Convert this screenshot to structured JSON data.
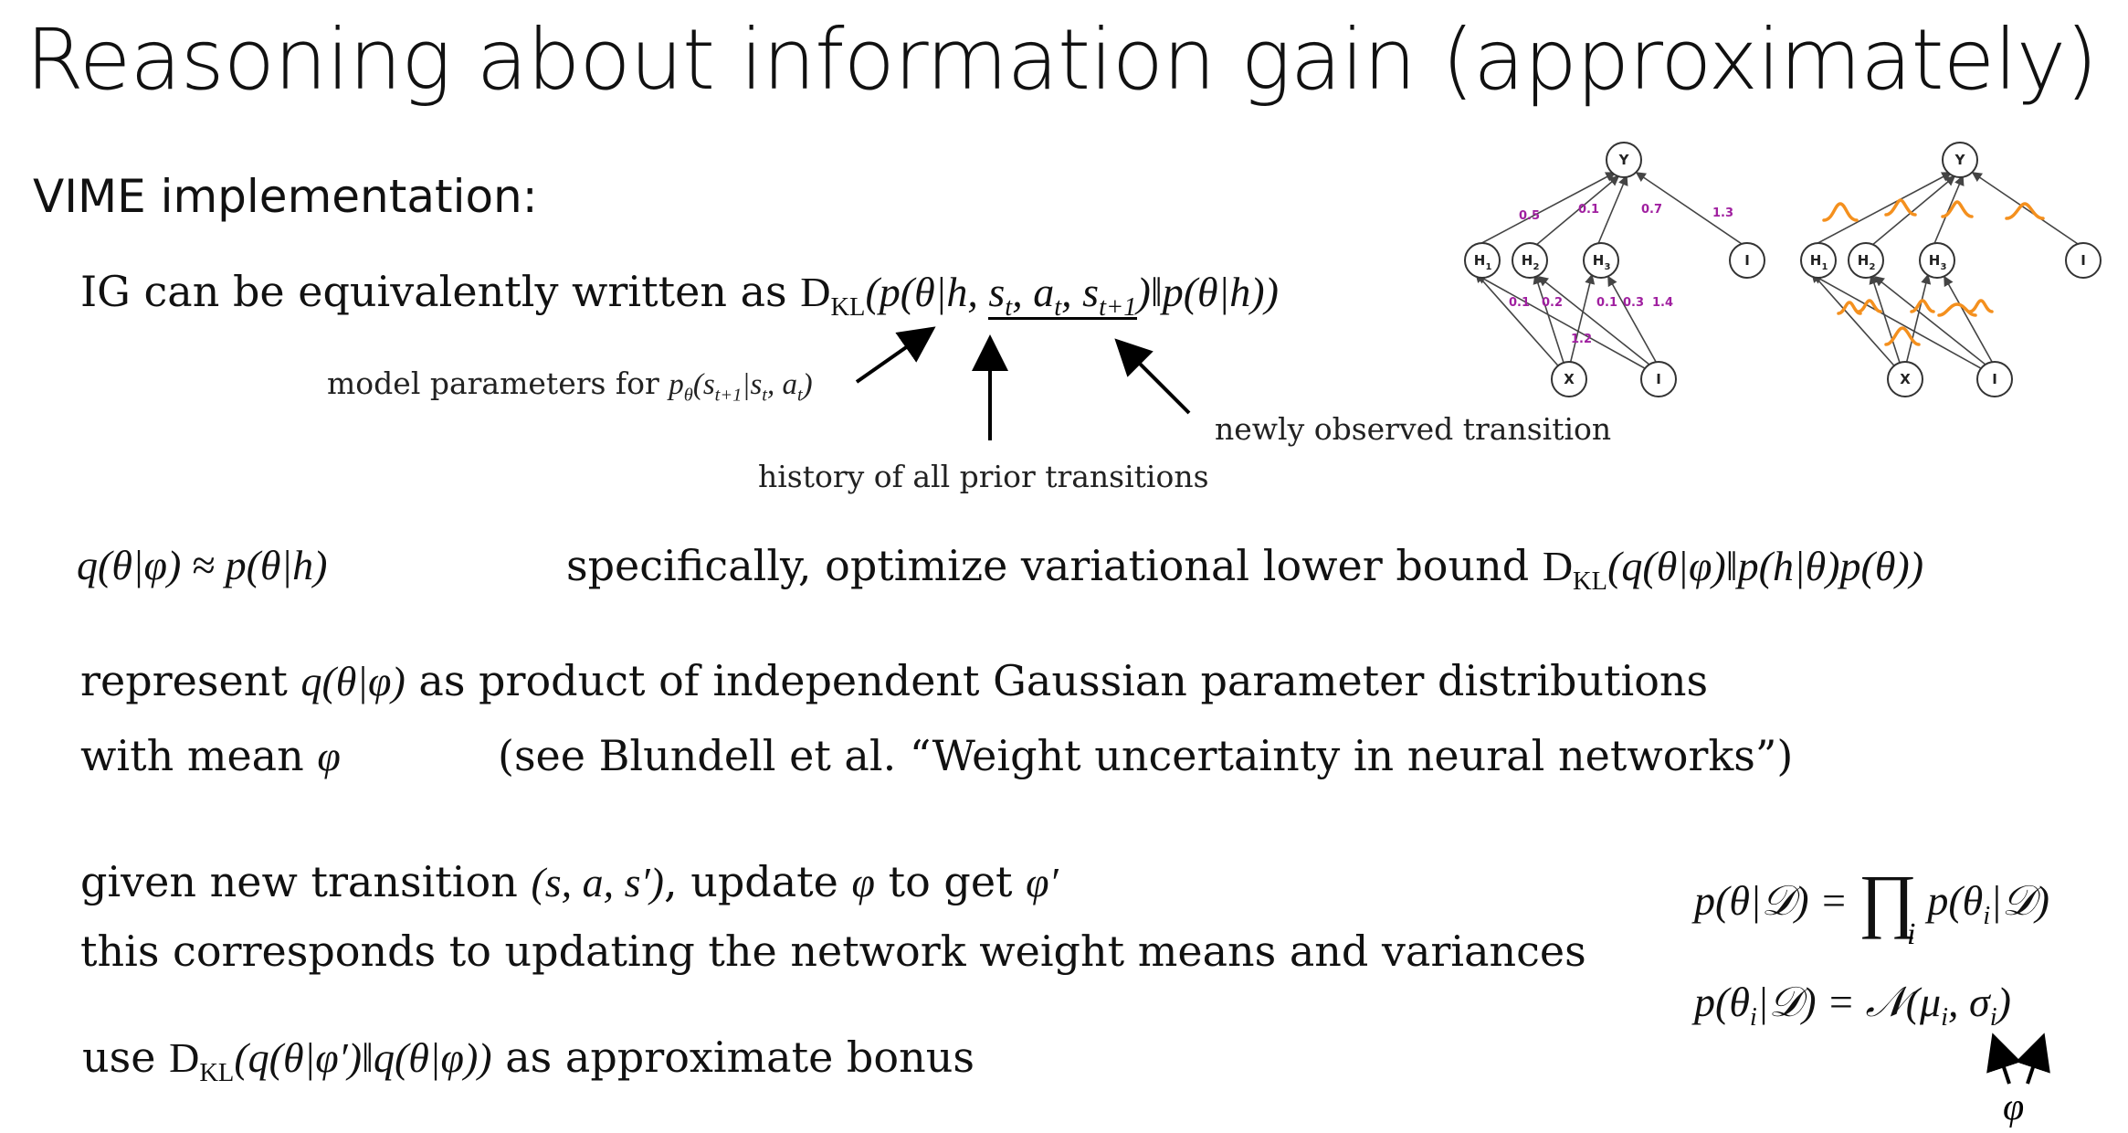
{
  "slide": {
    "title": "Reasoning about information gain (approximately)",
    "subtitle": "VIME implementation:"
  },
  "ig_line": {
    "prefix": "IG can be equivalently written as",
    "formula_part1": "D",
    "kl": "KL",
    "formula_part2": "(p(θ|h,",
    "transition": "s",
    "formula_part3": ")‖p(θ|h))"
  },
  "annotations": {
    "model_params_text": "model parameters for",
    "model_params_formula": "p",
    "history": "history of all prior transitions",
    "new_transition": "newly observed transition"
  },
  "q_line": {
    "left": "q(θ|φ) ≈ p(θ|h)",
    "text": "specifically, optimize variational lower bound",
    "formula": "(q(θ|φ)‖p(h|θ)p(θ))"
  },
  "represent": {
    "line1_a": "represent",
    "line1_math": "q(θ|φ)",
    "line1_b": "as product of independent Gaussian parameter distributions",
    "line2_a": "with mean",
    "line2_math": "φ",
    "line2_b": "(see Blundell et al. “Weight uncertainty in neural networks”)"
  },
  "update": {
    "line1_a": "given new transition",
    "line1_math1": "(s, a, s′)",
    "line1_b": ", update",
    "line1_math2": "φ",
    "line1_c": "to get",
    "line1_math3": "φ′",
    "line2": "this corresponds to updating the network weight means and variances"
  },
  "bonus": {
    "prefix": "use",
    "formula": "(q(θ|φ′)‖q(θ|φ))",
    "suffix": "as approximate bonus"
  },
  "equations": {
    "eq1_left": "p(θ|𝒟) =",
    "eq1_prod": "∏",
    "eq1_right": "p(θ",
    "eq1_right2": "|𝒟)",
    "eq1_sub": "i",
    "eq2": "p(θ",
    "eq2_b": "|𝒟) = 𝒩(μ",
    "eq2_c": ", σ",
    "eq2_d": ")",
    "phi": "φ"
  },
  "networks": {
    "nodes": {
      "output": "Y",
      "hidden1": "H",
      "hidden2": "H",
      "hidden3": "H",
      "bias": "I",
      "input": "X",
      "input_bias": "I",
      "sub1": "1",
      "sub2": "2",
      "sub3": "3"
    },
    "weights_top": [
      "0.5",
      "0.1",
      "0.7",
      "1.3"
    ],
    "weights_bottom": [
      "0.1",
      "0.2",
      "0.1",
      "0.3",
      "1.4",
      "1.2"
    ],
    "weight_color": "#a020a0",
    "gaussian_color": "#f4901e"
  }
}
